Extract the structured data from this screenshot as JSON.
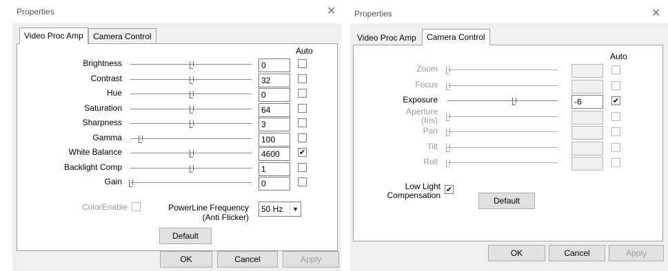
{
  "left_dialog": {
    "title": "Properties",
    "tabs": [
      "Video Proc Amp",
      "Camera Control"
    ],
    "auto_header": "Auto",
    "rows": [
      {
        "label": "Brightness",
        "value": "0",
        "auto": false,
        "position": 0.5
      },
      {
        "label": "Contrast",
        "value": "32",
        "auto": false,
        "position": 0.5
      },
      {
        "label": "Hue",
        "value": "0",
        "auto": false,
        "position": 0.5
      },
      {
        "label": "Saturation",
        "value": "64",
        "auto": false,
        "position": 0.5
      },
      {
        "label": "Sharpness",
        "value": "3",
        "auto": false,
        "position": 0.5
      },
      {
        "label": "Gamma",
        "value": "100",
        "auto": false,
        "position": 0.08
      },
      {
        "label": "White Balance",
        "value": "4600",
        "auto": true,
        "position": 0.5
      },
      {
        "label": "Backlight Comp",
        "value": "1",
        "auto": false,
        "position": 0.5
      },
      {
        "label": "Gain",
        "value": "0",
        "auto": false,
        "position": 0.0
      }
    ],
    "color_enable_label": "ColorEnable",
    "powerline_label_1": "PowerLine Frequency",
    "powerline_label_2": "(Anti Flicker)",
    "powerline_value": "50 Hz",
    "default_button": "Default",
    "ok": "OK",
    "cancel": "Cancel",
    "apply": "Apply"
  },
  "right_dialog": {
    "title": "Properties",
    "tabs": [
      "Video Proc Amp",
      "Camera Control"
    ],
    "auto_header": "Auto",
    "rows": [
      {
        "label": "Zoom",
        "value": "",
        "auto": false,
        "enabled": false,
        "position": 0.0
      },
      {
        "label": "Focus",
        "value": "",
        "auto": false,
        "enabled": false,
        "position": 0.0
      },
      {
        "label": "Exposure",
        "value": "-6",
        "auto": true,
        "enabled": true,
        "position": 0.6
      },
      {
        "label": "Aperture\n(Iris)",
        "value": "",
        "auto": false,
        "enabled": false,
        "position": 0.0
      },
      {
        "label": "Pan",
        "value": "",
        "auto": false,
        "enabled": false,
        "position": 0.0
      },
      {
        "label": "Tilt",
        "value": "",
        "auto": false,
        "enabled": false,
        "position": 0.0
      },
      {
        "label": "Roll",
        "value": "",
        "auto": false,
        "enabled": false,
        "position": 0.0
      }
    ],
    "low_light_label_1": "Low Light",
    "low_light_label_2": "Compensation",
    "low_light_checked": true,
    "default_button": "Default",
    "ok": "OK",
    "cancel": "Cancel",
    "apply": "Apply"
  }
}
